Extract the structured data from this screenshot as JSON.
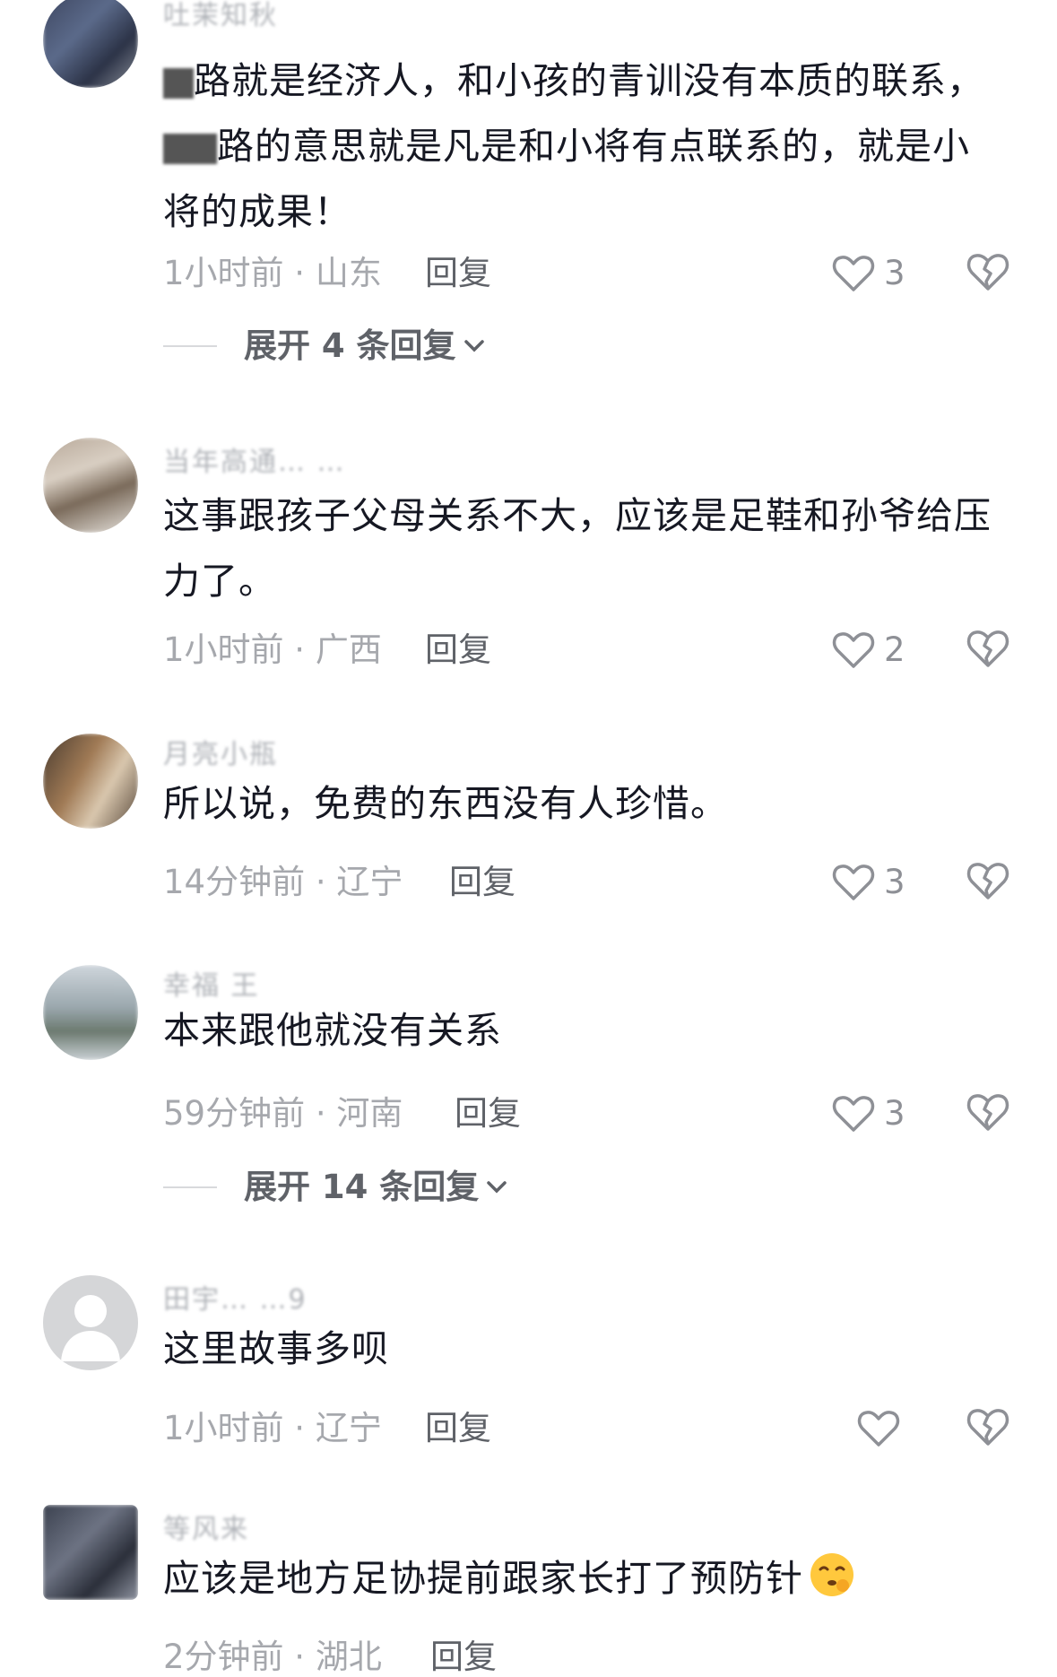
{
  "comments": [
    {
      "username": "吐茉知秋",
      "content_parts": [
        "路就是经济人，和小孩的青训没有本质的联系，",
        "路的意思就是凡是和小将有点联系的，就是小将的成果！"
      ],
      "time": "1小时前",
      "location": "山东",
      "reply_label": "回复",
      "likes": "3",
      "expand_label": "展开 4 条回复"
    },
    {
      "username": "当年高通…  …",
      "content": "这事跟孩子父母关系不大，应该是足鞋和孙爷给压力了。",
      "time": "1小时前",
      "location": "广西",
      "reply_label": "回复",
      "likes": "2"
    },
    {
      "username": "月亮小瓶",
      "content": "所以说，免费的东西没有人珍惜。",
      "time": "14分钟前",
      "location": "辽宁",
      "reply_label": "回复",
      "likes": "3"
    },
    {
      "username": "幸福  王",
      "content": "本来跟他就没有关系",
      "time": "59分钟前",
      "location": "河南",
      "reply_label": "回复",
      "likes": "3",
      "expand_label": "展开 14 条回复"
    },
    {
      "username": "田宇…  …9",
      "content": "这里故事多呗",
      "time": "1小时前",
      "location": "辽宁",
      "reply_label": "回复",
      "likes": ""
    },
    {
      "username": "等风来",
      "content": "应该是地方足协提前跟家长打了预防针",
      "time": "2分钟前",
      "location": "湖北",
      "reply_label": "回复",
      "likes": ""
    }
  ],
  "meta_separator": " · ",
  "colors": {
    "text": "#161823",
    "meta": "#a6a8ad",
    "reply": "#5f6268",
    "icon": "#8e9096"
  },
  "icons": {
    "like": "heart-outline-icon",
    "dislike": "broken-heart-icon",
    "expand": "chevron-down-icon",
    "emoji": "shushing-face-emoji"
  }
}
